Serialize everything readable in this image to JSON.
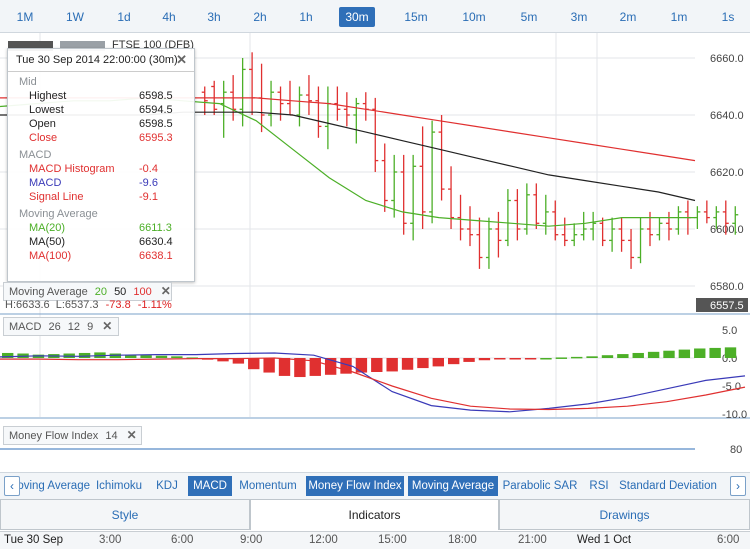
{
  "timeframes": [
    "1M",
    "1W",
    "1d",
    "4h",
    "3h",
    "2h",
    "1h",
    "30m",
    "15m",
    "10m",
    "5m",
    "3m",
    "2m",
    "1m",
    "1s"
  ],
  "active_timeframe": "30m",
  "instrument_label": "FTSE 100 (DFB)",
  "tooltip": {
    "title": "Tue 30 Sep 2014 22:00:00 (30m)",
    "sections": [
      {
        "heading": "Mid",
        "rows": [
          {
            "label": "Highest",
            "value": "6598.5",
            "color": "#222"
          },
          {
            "label": "Lowest",
            "value": "6594.5",
            "color": "#222"
          },
          {
            "label": "Open",
            "value": "6598.5",
            "color": "#222"
          },
          {
            "label": "Close",
            "value": "6595.3",
            "color": "#e03030"
          }
        ]
      },
      {
        "heading": "MACD",
        "rows": [
          {
            "label": "MACD Histogram",
            "value": "-0.4",
            "color": "#e03030"
          },
          {
            "label": "MACD",
            "value": "-9.6",
            "color": "#3a3ab8"
          },
          {
            "label": "Signal Line",
            "value": "-9.1",
            "color": "#e03030"
          }
        ]
      },
      {
        "heading": "Moving Average",
        "rows": [
          {
            "label": "MA(20)",
            "value": "6611.3",
            "color": "#4caf27"
          },
          {
            "label": "MA(50)",
            "value": "6630.4",
            "color": "#222"
          },
          {
            "label": "MA(100)",
            "value": "6638.1",
            "color": "#e03030"
          }
        ]
      }
    ]
  },
  "price_axis": {
    "ticks": [
      "6660.0",
      "6640.0",
      "6620.0",
      "6600.0",
      "6580.0"
    ],
    "current": "6557.5"
  },
  "ma_legend": {
    "label": "Moving Average",
    "periods": [
      "20",
      "50",
      "100"
    ]
  },
  "hl_readout": {
    "high": "H:6633.6",
    "low": "L:6537.3",
    "change": "-73.8",
    "change_pct": "-1.11%"
  },
  "macd_legend": {
    "label": "MACD",
    "params": [
      "26",
      "12",
      "9"
    ]
  },
  "macd_axis": {
    "ticks": [
      "5.0",
      "0.0",
      "-5.0",
      "-10.0"
    ]
  },
  "mfi_legend": {
    "label": "Money Flow Index",
    "period": "14"
  },
  "mfi_axis": {
    "ticks": [
      "80"
    ]
  },
  "indicator_tabs": [
    {
      "label": "Moving Average",
      "active": false,
      "clipped": true
    },
    {
      "label": "Ichimoku",
      "active": false
    },
    {
      "label": "KDJ",
      "active": false
    },
    {
      "label": "MACD",
      "active": true
    },
    {
      "label": "Momentum",
      "active": false
    },
    {
      "label": "Money Flow Index",
      "active": true
    },
    {
      "label": "Moving Average",
      "active": true
    },
    {
      "label": "Parabolic SAR",
      "active": false
    },
    {
      "label": "RSI",
      "active": false
    },
    {
      "label": "Standard Deviation",
      "active": false
    }
  ],
  "segments": {
    "style": "Style",
    "indicators": "Indicators",
    "drawings": "Drawings",
    "active": "indicators"
  },
  "time_axis": [
    "Tue 30 Sep",
    "3:00",
    "6:00",
    "9:00",
    "12:00",
    "15:00",
    "18:00",
    "21:00",
    "Wed 1 Oct",
    "6:00"
  ],
  "colors": {
    "accent": "#2f6fb8",
    "up": "#4caf27",
    "down": "#e03030",
    "ma50": "#222222",
    "macd": "#3a3ab8"
  },
  "chart_data": {
    "type": "line",
    "title": "FTSE 100 (DFB)",
    "ylim": [
      6550,
      6670
    ],
    "candles_count": 60,
    "series": [
      {
        "name": "MA(20)",
        "last": 6611.3
      },
      {
        "name": "MA(50)",
        "last": 6630.4
      },
      {
        "name": "MA(100)",
        "last": 6638.1
      }
    ]
  }
}
